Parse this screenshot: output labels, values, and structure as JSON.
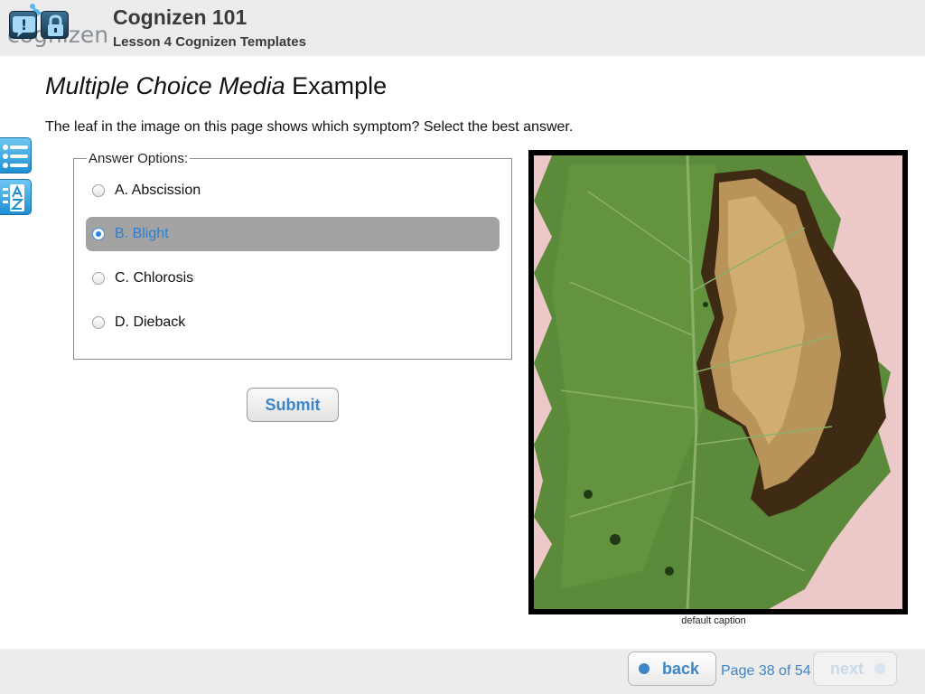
{
  "header": {
    "logo_text": "cognizen",
    "course_title": "Cognizen 101",
    "lesson_title": "Lesson 4 Cognizen Templates"
  },
  "page": {
    "title_italic": "Multiple Choice Media",
    "title_rest": " Example",
    "question": "The leaf in the image on this page shows which symptom? Select the best answer."
  },
  "answers": {
    "legend": "Answer Options:",
    "options": [
      {
        "label": "A. Abscission",
        "selected": false
      },
      {
        "label": "B. Blight",
        "selected": true
      },
      {
        "label": "C. Chlorosis",
        "selected": false
      },
      {
        "label": "D. Dieback",
        "selected": false
      }
    ],
    "submit_label": "Submit"
  },
  "media": {
    "caption": "default caption"
  },
  "side_tools": {
    "menu_icon": "list-icon",
    "glossary_icon": "az-glossary-icon"
  },
  "footer": {
    "help_icon": "help-icon",
    "lock_icon": "lock-icon",
    "back_label": "back",
    "next_label": "next",
    "page_count": "Page 38 of 54"
  },
  "colors": {
    "accent": "#3d85c6",
    "selected_bg": "#a3a3a3",
    "header_bg": "#ececec"
  }
}
